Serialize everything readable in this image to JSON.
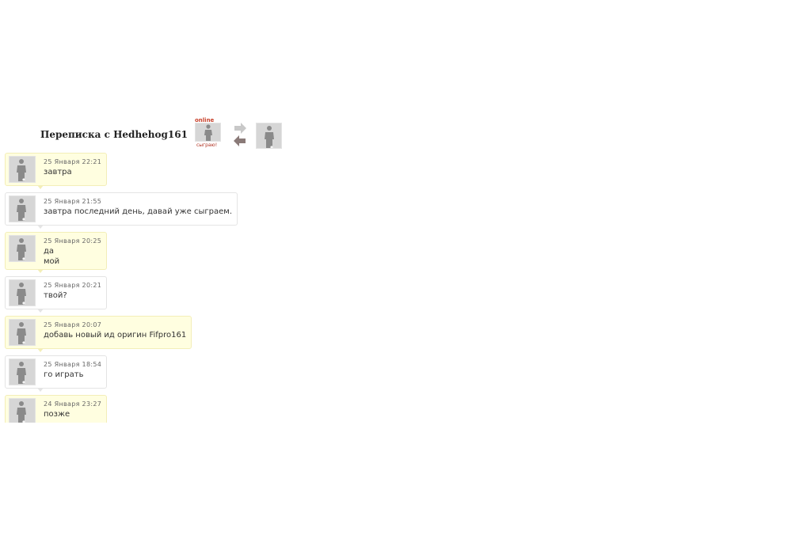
{
  "header": {
    "title": "Переписка с Hedhehog161",
    "peer_status": "online",
    "peer_play_label": "сыграю!",
    "peer_avatar_icon": "player-silhouette-icon",
    "swap_icon": "swap-arrows-icon",
    "my_avatar_icon": "player-silhouette-icon"
  },
  "colors": {
    "incoming_bg": "#fffee0",
    "outgoing_bg": "#ffffff",
    "online": "#c8402a"
  },
  "messages": [
    {
      "time": "25 Января 22:21",
      "text": "завтра",
      "kind": "in"
    },
    {
      "time": "25 Января 21:55",
      "text": "завтра последний день, давай уже сыграем.",
      "kind": "out"
    },
    {
      "time": "25 Января 20:25",
      "text": "да\nмой",
      "kind": "in"
    },
    {
      "time": "25 Января 20:21",
      "text": "твой?",
      "kind": "out"
    },
    {
      "time": "25 Января 20:07",
      "text": "добавь новый ид оригин Fifpro161",
      "kind": "in"
    },
    {
      "time": "25 Января 18:54",
      "text": "го играть",
      "kind": "out"
    },
    {
      "time": "24 Января 23:27",
      "text": "позже",
      "kind": "in"
    }
  ]
}
